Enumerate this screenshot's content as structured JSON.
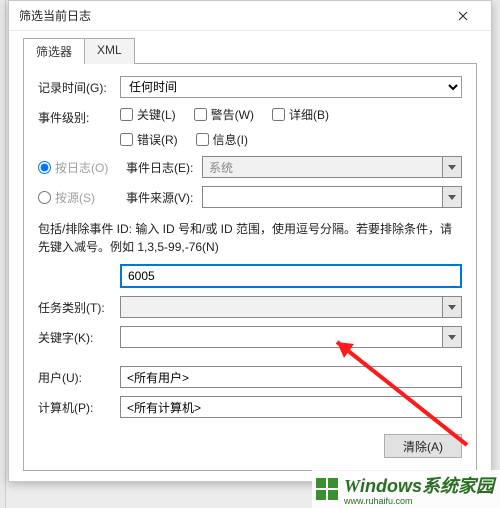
{
  "window": {
    "title": "筛选当前日志"
  },
  "tabs": {
    "filter": "筛选器",
    "xml": "XML"
  },
  "labels": {
    "logged": "记录时间(G):",
    "level": "事件级别:",
    "by_log": "按日志(O)",
    "by_source": "按源(S)",
    "event_log": "事件日志(E):",
    "event_source": "事件来源(V):",
    "id_hint": "包括/排除事件 ID: 输入 ID 号和/或 ID 范围，使用逗号分隔。若要排除条件，请先键入减号。例如 1,3,5-99,-76(N)",
    "task_category": "任务类别(T):",
    "keywords": "关键字(K):",
    "user": "用户(U):",
    "computer": "计算机(P):",
    "clear": "清除(A)"
  },
  "values": {
    "time_range": "任何时间",
    "event_log": "系统",
    "event_source": "",
    "event_id": "6005",
    "task_category": "",
    "keywords": "",
    "user": "<所有用户>",
    "computer": "<所有计算机>"
  },
  "levels": {
    "critical": "关键(L)",
    "warning": "警告(W)",
    "verbose": "详细(B)",
    "error": "错误(R)",
    "information": "信息(I)"
  },
  "watermark": {
    "main": "indows系统家园",
    "sub": "www.ruhaifu.com"
  }
}
